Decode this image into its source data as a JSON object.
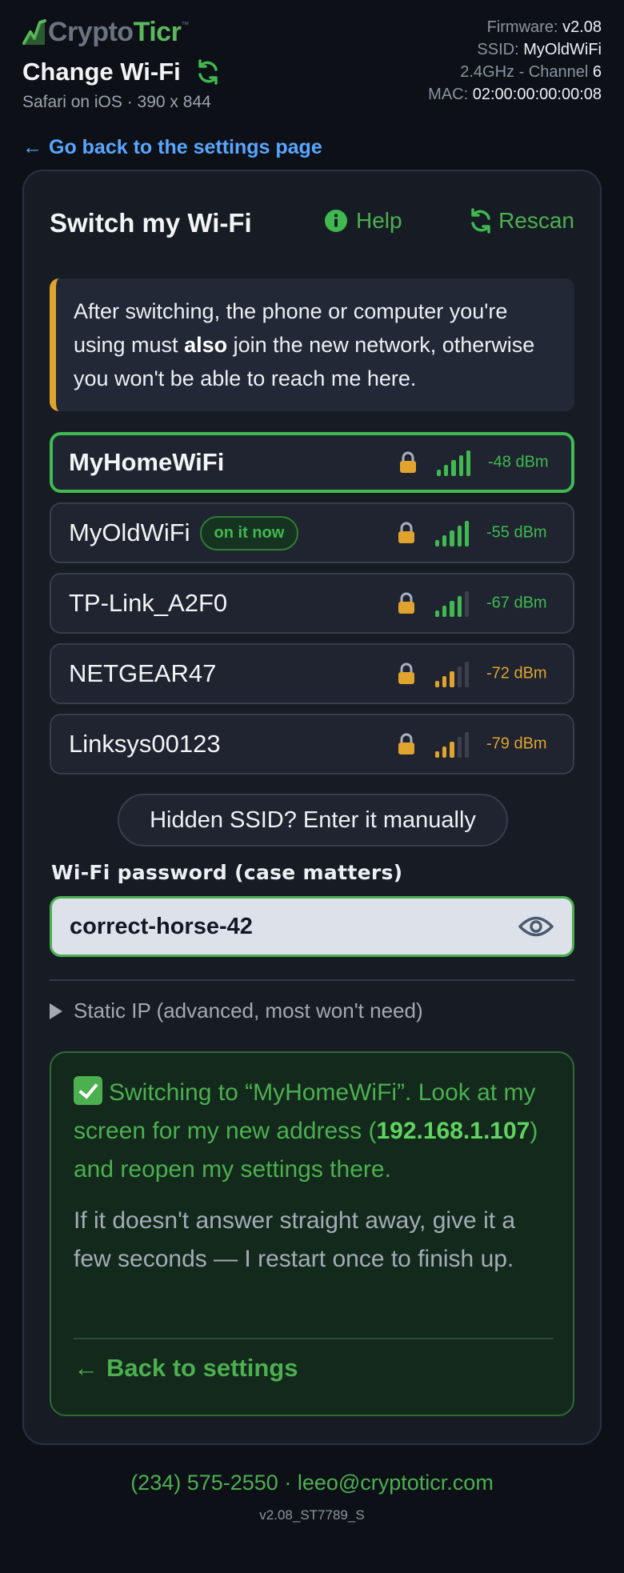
{
  "brand": {
    "name_part1": "Crypto",
    "name_part2": "Ticr",
    "tm": "™",
    "icon": "logo-graph-icon"
  },
  "header": {
    "title": "Change Wi-Fi",
    "refresh_icon": "refresh-icon",
    "device": "Safari on iOS · 390 x 844"
  },
  "device_info": {
    "firmware_label": "Firmware:",
    "firmware_value": "v2.08",
    "ssid_label": "SSID:",
    "ssid_value": "MyOldWiFi",
    "band_label": "2.4GHz - Channel",
    "band_value": "6",
    "mac_label": "MAC:",
    "mac_value": "02:00:00:00:00:08"
  },
  "nav": {
    "back_arrow": "←",
    "back_label": "Go back to the settings page"
  },
  "card": {
    "title": "Switch my Wi-Fi",
    "help_label": "Help",
    "help_icon": "info-icon",
    "rescan_label": "Rescan",
    "rescan_icon": "refresh-icon"
  },
  "note": {
    "part1": "After switching, the phone or computer you're using must ",
    "bold": "also",
    "part2": " join the new network, otherwise you won't be able to reach me here."
  },
  "networks": [
    {
      "name": "MyHomeWiFi",
      "badge": "",
      "rssi": "-48 dBm",
      "bars": 5,
      "secured": true,
      "selected": true
    },
    {
      "name": "MyOldWiFi",
      "badge": "on it now",
      "rssi": "-55 dBm",
      "bars": 5,
      "secured": true,
      "selected": false
    },
    {
      "name": "TP-Link_A2F0",
      "badge": "",
      "rssi": "-67 dBm",
      "bars": 4,
      "secured": true,
      "selected": false
    },
    {
      "name": "NETGEAR47",
      "badge": "",
      "rssi": "-72 dBm",
      "bars": 3,
      "secured": true,
      "selected": false
    },
    {
      "name": "Linksys00123",
      "badge": "",
      "rssi": "-79 dBm",
      "bars": 3,
      "secured": true,
      "selected": false
    }
  ],
  "colors": {
    "accent": "#3fb950",
    "strong_signal": "#3fb950",
    "weak_signal": "#e0a32e",
    "empty_bar": "#3a404c",
    "note_border": "#e0a32e",
    "link": "#58a6ff"
  },
  "hidden_ssid_label": "Hidden SSID? Enter it manually",
  "password": {
    "label": "Wi-Fi password (case matters)",
    "value": "correct-horse-42",
    "eye_icon": "eye-icon"
  },
  "static_ip_label": "Static IP (advanced, most won't need)",
  "success": {
    "line1": "Switching to “MyHomeWiFi”. Look at my screen for my new address (",
    "ip": "192.168.1.107",
    "line2": ") and reopen my settings there.",
    "sub": "If it doesn't answer straight away, give it a few seconds — I restart once to finish up.",
    "back_arrow": "←",
    "back_label": "Back to settings"
  },
  "footer": {
    "contact": "(234) 575-2550 · leeo@cryptoticr.com",
    "version": "v2.08_ST7789_S"
  }
}
